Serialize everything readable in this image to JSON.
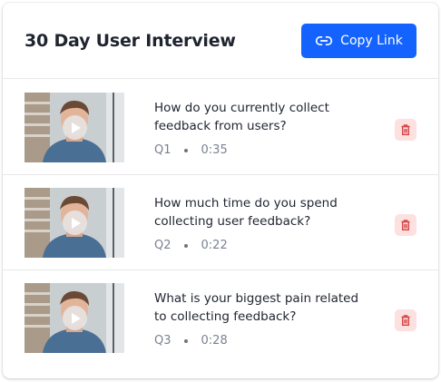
{
  "header": {
    "title": "30 Day User Interview",
    "copy_link_label": "Copy Link",
    "copy_link_icon": "link-icon"
  },
  "questions": [
    {
      "line1": "How do you currently collect",
      "line2": "feedback from users?",
      "number": "Q1",
      "duration": "0:35"
    },
    {
      "line1": "How much time do you spend",
      "line2": "collecting user feedback?",
      "number": "Q2",
      "duration": "0:22"
    },
    {
      "line1": "What is your biggest pain related",
      "line2": "to collecting feedback?",
      "number": "Q3",
      "duration": "0:28"
    }
  ],
  "icons": {
    "play": "play-icon",
    "delete": "trash-icon"
  },
  "colors": {
    "primary": "#1463ff",
    "danger_bg": "#fde0e0",
    "danger_icon": "#d64545"
  }
}
